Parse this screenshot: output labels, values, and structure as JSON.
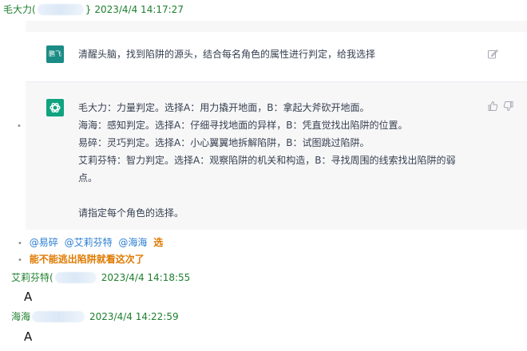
{
  "messages": [
    {
      "sender": "毛大力",
      "sender_suffix": "(",
      "time_trail": "}",
      "timestamp": "2023/4/4 14:17:27"
    },
    {
      "sender": "艾莉芬特",
      "sender_suffix": "(",
      "timestamp": "2023/4/4 14:18:55",
      "reply": "A"
    },
    {
      "sender": "海海",
      "timestamp": "2023/4/4 14:22:59",
      "reply": "A"
    }
  ],
  "chat_card": {
    "user_avatar_label": "鹏飞",
    "question": "清醒头脑，找到陷阱的源头，结合每名角色的属性进行判定，给我选择",
    "answer_lines": [
      "毛大力：力量判定。选择A：用力撬开地面，B：拿起大斧砍开地面。",
      "海海：感知判定。选择A：仔细寻找地面的异样，B：凭直觉找出陷阱的位置。",
      "易碎：灵巧判定。选择A：小心翼翼地拆解陷阱，B：试图跳过陷阱。",
      "艾莉芬特：智力判定。选择A：观察陷阱的机关和构造，B：寻找周围的线索找出陷阱的弱",
      "点。",
      "",
      "请指定每个角色的选择。"
    ]
  },
  "mentions": [
    "@易碎",
    "@艾莉芬特",
    "@海海"
  ],
  "mention_action": "选",
  "followup": "能不能逃出陷阱就看这次了",
  "colors": {
    "sender_green": "#1d7f2e",
    "mention_blue": "#2a7ed2",
    "orange": "#e07a00",
    "gpt_green": "#10a37f",
    "user_avatar_teal": "#1a8c85"
  }
}
